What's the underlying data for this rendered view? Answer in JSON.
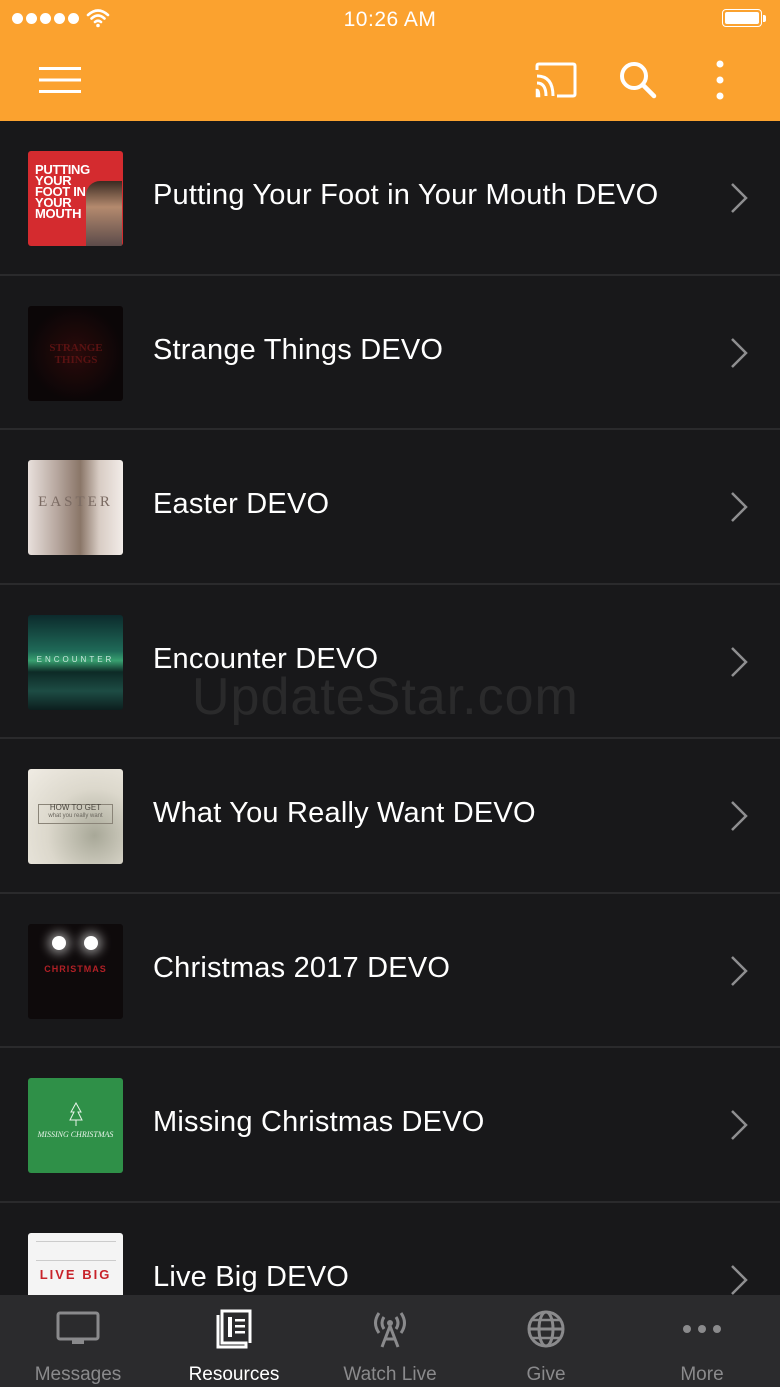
{
  "colors": {
    "header_bg": "#fba22f",
    "list_bg": "#18181a",
    "tabbar_bg": "#2b2b2d",
    "active_tab": "#ffffff",
    "inactive_tab": "#8a8a8c"
  },
  "status_bar": {
    "time": "10:26 AM"
  },
  "toolbar": {
    "menu_icon": "hamburger-menu-icon",
    "cast_icon": "cast-icon",
    "search_icon": "search-icon",
    "more_icon": "more-vertical-icon"
  },
  "resources": [
    {
      "title": "Putting Your Foot in Your Mouth DEVO",
      "thumb_text": "PUTTING YOUR FOOT IN YOUR MOUTH"
    },
    {
      "title": "Strange Things DEVO",
      "thumb_text": "STRANGE THINGS"
    },
    {
      "title": "Easter DEVO",
      "thumb_text": "EASTER"
    },
    {
      "title": "Encounter DEVO",
      "thumb_text": "ENCOUNTER"
    },
    {
      "title": "What You Really Want DEVO",
      "thumb_text": "HOW TO GET",
      "thumb_subtext": "what you really want"
    },
    {
      "title": "Christmas 2017 DEVO",
      "thumb_text": "CHRISTMAS"
    },
    {
      "title": "Missing Christmas DEVO",
      "thumb_text": "MISSING CHRISTMAS"
    },
    {
      "title": "Live Big DEVO",
      "thumb_text": "LIVE BIG"
    }
  ],
  "watermark": "UpdateStar.com",
  "tabs": [
    {
      "label": "Messages",
      "icon": "monitor-icon",
      "active": false
    },
    {
      "label": "Resources",
      "icon": "book-icon",
      "active": true
    },
    {
      "label": "Watch Live",
      "icon": "broadcast-antenna-icon",
      "active": false
    },
    {
      "label": "Give",
      "icon": "globe-icon",
      "active": false
    },
    {
      "label": "More",
      "icon": "more-horizontal-icon",
      "active": false
    }
  ]
}
